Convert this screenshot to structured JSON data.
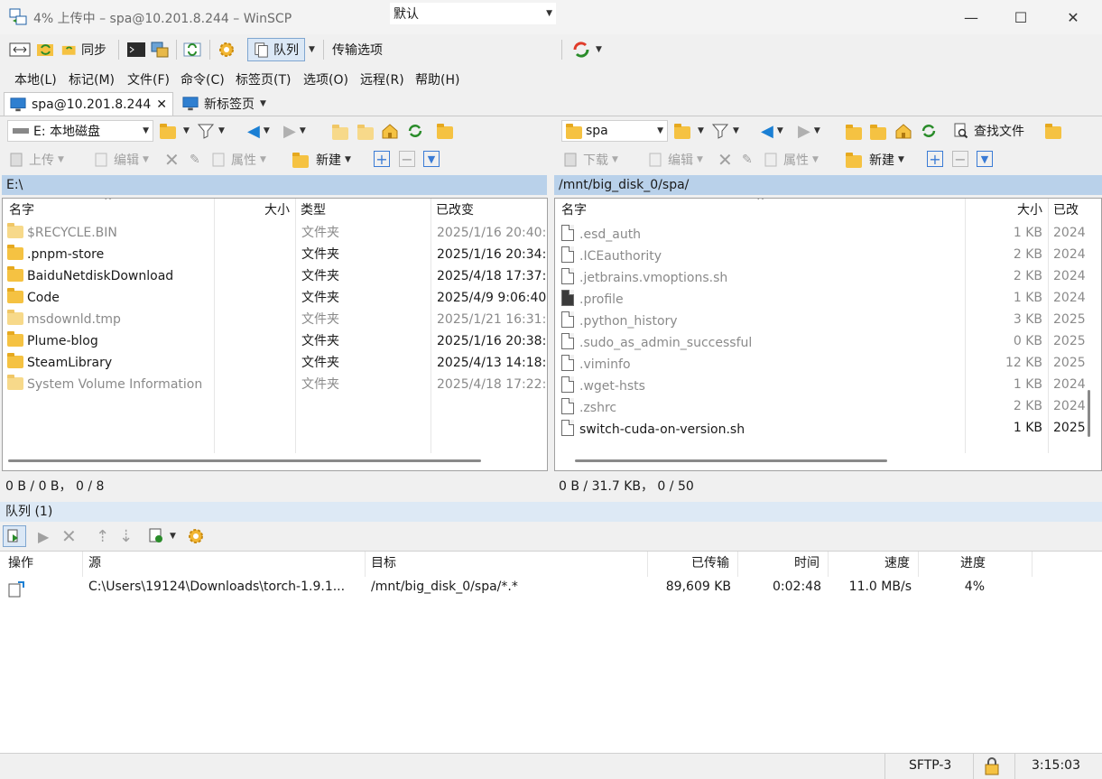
{
  "window": {
    "title": "4% 上传中 – spa@10.201.8.244 – WinSCP",
    "minimize": "—",
    "maximize": "☐",
    "close": "✕"
  },
  "toolbar": {
    "sync_label": "同步",
    "queue_label": "队列",
    "transfer_options_label": "传输选项",
    "transfer_preset": "默认"
  },
  "menu": [
    "本地(L)",
    "标记(M)",
    "文件(F)",
    "命令(C)",
    "标签页(T)",
    "选项(O)",
    "远程(R)",
    "帮助(H)"
  ],
  "tabs": {
    "session": "spa@10.201.8.244",
    "close": "✕",
    "new_tab": "新标签页"
  },
  "local": {
    "drive": "E: 本地磁盘",
    "upload_label": "上传",
    "edit_label": "编辑",
    "properties_label": "属性",
    "new_label": "新建",
    "path": "E:\\",
    "columns": {
      "name": "名字",
      "size": "大小",
      "type": "类型",
      "changed": "已改变"
    },
    "rows": [
      {
        "name": "$RECYCLE.BIN",
        "type": "文件夹",
        "changed": "2025/1/16 20:40:",
        "hidden": true
      },
      {
        "name": ".pnpm-store",
        "type": "文件夹",
        "changed": "2025/1/16 20:34:",
        "hidden": false
      },
      {
        "name": "BaiduNetdiskDownload",
        "type": "文件夹",
        "changed": "2025/4/18 17:37:",
        "hidden": false
      },
      {
        "name": "Code",
        "type": "文件夹",
        "changed": "2025/4/9 9:06:40",
        "hidden": false
      },
      {
        "name": "msdownld.tmp",
        "type": "文件夹",
        "changed": "2025/1/21 16:31:",
        "hidden": true
      },
      {
        "name": "Plume-blog",
        "type": "文件夹",
        "changed": "2025/1/16 20:38:",
        "hidden": false
      },
      {
        "name": "SteamLibrary",
        "type": "文件夹",
        "changed": "2025/4/13 14:18:",
        "hidden": false
      },
      {
        "name": "System Volume Information",
        "type": "文件夹",
        "changed": "2025/4/18 17:22:",
        "hidden": true
      }
    ],
    "status": "0 B / 0 B， 0 / 8"
  },
  "remote": {
    "folder": "spa",
    "download_label": "下载",
    "edit_label": "编辑",
    "properties_label": "属性",
    "new_label": "新建",
    "find_label": "查找文件",
    "path": "/mnt/big_disk_0/spa/",
    "columns": {
      "name": "名字",
      "size": "大小",
      "changed": "已改"
    },
    "rows": [
      {
        "name": ".esd_auth",
        "size": "1 KB",
        "changed": "2024",
        "hidden": true,
        "dark": false
      },
      {
        "name": ".ICEauthority",
        "size": "2 KB",
        "changed": "2024",
        "hidden": true,
        "dark": false
      },
      {
        "name": ".jetbrains.vmoptions.sh",
        "size": "2 KB",
        "changed": "2024",
        "hidden": true,
        "dark": false
      },
      {
        "name": ".profile",
        "size": "1 KB",
        "changed": "2024",
        "hidden": true,
        "dark": true
      },
      {
        "name": ".python_history",
        "size": "3 KB",
        "changed": "2025",
        "hidden": true,
        "dark": false
      },
      {
        "name": ".sudo_as_admin_successful",
        "size": "0 KB",
        "changed": "2025",
        "hidden": true,
        "dark": false
      },
      {
        "name": ".viminfo",
        "size": "12 KB",
        "changed": "2025",
        "hidden": true,
        "dark": false
      },
      {
        "name": ".wget-hsts",
        "size": "1 KB",
        "changed": "2024",
        "hidden": true,
        "dark": false
      },
      {
        "name": ".zshrc",
        "size": "2 KB",
        "changed": "2024",
        "hidden": true,
        "dark": false
      },
      {
        "name": "switch-cuda-on-version.sh",
        "size": "1 KB",
        "changed": "2025",
        "hidden": false,
        "dark": false
      }
    ],
    "status": "0 B / 31.7 KB， 0 / 50"
  },
  "queue": {
    "title": "队列 (1)",
    "columns": {
      "op": "操作",
      "source": "源",
      "target": "目标",
      "transferred": "已传输",
      "time": "时间",
      "speed": "速度",
      "progress": "进度"
    },
    "items": [
      {
        "source": "C:\\Users\\19124\\Downloads\\torch-1.9.1...",
        "target": "/mnt/big_disk_0/spa/*.*",
        "transferred": "89,609 KB",
        "time": "0:02:48",
        "speed": "11.0 MB/s",
        "progress": "4%"
      }
    ]
  },
  "statusbar": {
    "protocol": "SFTP-3",
    "elapsed": "3:15:03"
  }
}
